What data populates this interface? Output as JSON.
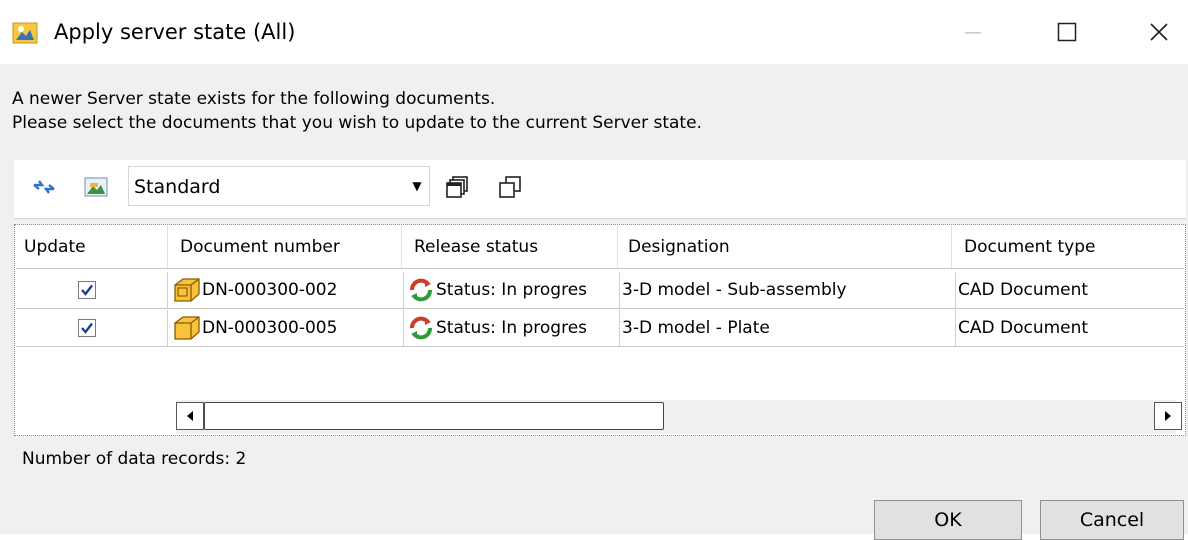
{
  "window": {
    "title": "Apply server state (All)",
    "minimize_symbol": "—",
    "maximize_symbol": "☐",
    "close_symbol": "✕"
  },
  "message": {
    "line1": "A newer Server state exists for the following documents.",
    "line2": "Please select the documents that you wish to update to the current Server state."
  },
  "toolbar": {
    "refresh_icon": "refresh-arrows-icon",
    "image_icon": "image-picture-icon",
    "view_selected": "Standard",
    "copy_icon": "copy-windows-icon",
    "window_icon": "window-stack-icon"
  },
  "table": {
    "columns": [
      "Update",
      "Document number",
      "Release status",
      "Designation",
      "Document type"
    ],
    "rows": [
      {
        "update": true,
        "doc_icon": "assembly-cube-icon",
        "document_number": "DN-000300-002",
        "status_icon": "sync-status-icon",
        "release_status": "Status: In progres",
        "designation": "3-D model - Sub-assembly",
        "document_type": "CAD Document"
      },
      {
        "update": true,
        "doc_icon": "part-cube-icon",
        "document_number": "DN-000300-005",
        "status_icon": "sync-status-icon",
        "release_status": "Status: In progres",
        "designation": "3-D model - Plate",
        "document_type": "CAD Document"
      }
    ]
  },
  "status": {
    "records_text": "Number of data records: 2"
  },
  "buttons": {
    "ok": "OK",
    "cancel": "Cancel"
  },
  "colors": {
    "dialog_bg": "#f0f0f0",
    "checkmark": "#1c3f94",
    "cube_fill": "#f7c33c",
    "status_green": "#2e9a3a",
    "status_red": "#d13b2a"
  }
}
